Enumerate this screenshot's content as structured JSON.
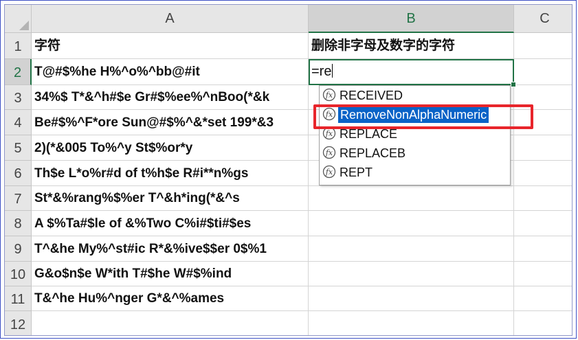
{
  "columns": [
    "A",
    "B",
    "C"
  ],
  "rows": [
    {
      "num": "1",
      "a": "字符",
      "b": "删除非字母及数字的字符"
    },
    {
      "num": "2",
      "a": "T@#$%he H%^o%^bb@#it",
      "b": ""
    },
    {
      "num": "3",
      "a": "34%$ T*&^h#$e Gr#$%ee%^nBoo(*&k",
      "b": ""
    },
    {
      "num": "4",
      "a": "Be#$%^F*ore Sun@#$%^&*set 199*&3",
      "b": ""
    },
    {
      "num": "5",
      "a": "2)(*&005 To%^y St$%or*y",
      "b": ""
    },
    {
      "num": "6",
      "a": "Th$e L*o%r#d of t%h$e R#i**n%gs",
      "b": ""
    },
    {
      "num": "7",
      "a": "St*&%rang%$%er T^&h*ing(*&^s",
      "b": ""
    },
    {
      "num": "8",
      "a": "A $%Ta#$le of &%Two C%i#$ti#$es",
      "b": ""
    },
    {
      "num": "9",
      "a": "T^&he My%^st#ic R*&%ive$$er 0$%1",
      "b": ""
    },
    {
      "num": "10",
      "a": "G&o$n$e W*ith T#$he W#$%ind",
      "b": ""
    },
    {
      "num": "11",
      "a": "T&^he Hu%^nger G*&^%ames",
      "b": ""
    },
    {
      "num": "12",
      "a": "",
      "b": ""
    }
  ],
  "editing": {
    "cell": "B2",
    "text": "=re"
  },
  "autocomplete": {
    "items": [
      {
        "label": "RECEIVED",
        "icon": "function-icon"
      },
      {
        "label": "RemoveNonAlphaNumeric",
        "icon": "function-icon"
      },
      {
        "label": "REPLACE",
        "icon": "function-icon"
      },
      {
        "label": "REPLACEB",
        "icon": "function-icon"
      },
      {
        "label": "REPT",
        "icon": "function-icon"
      }
    ],
    "highlighted": "RemoveNonAlphaNumeric"
  },
  "colors": {
    "accent": "#217346",
    "highlight": "#0a63c7",
    "annotation": "#e8252b",
    "frame": "#3b4fc4"
  }
}
